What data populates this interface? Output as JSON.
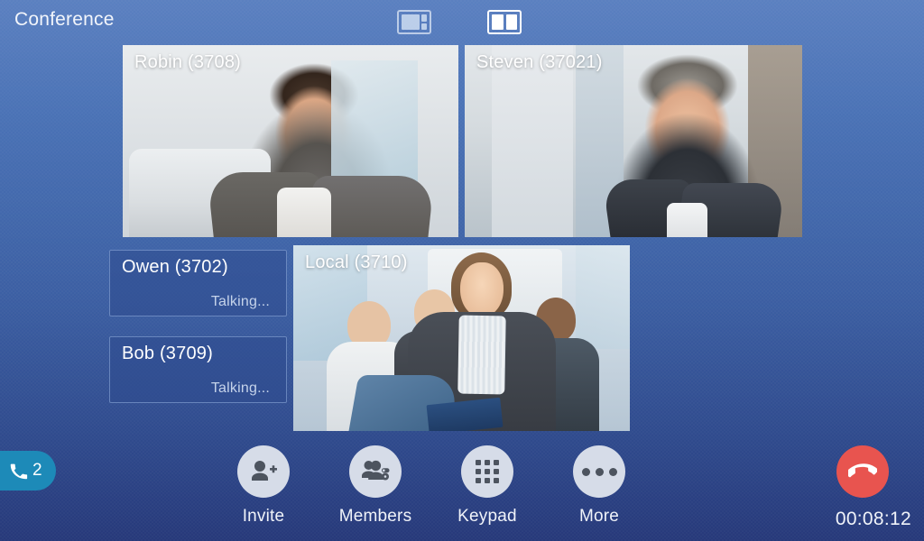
{
  "header": {
    "title": "Conference",
    "layout_buttons": [
      {
        "name": "layout-one-plus-two",
        "active": false
      },
      {
        "name": "layout-two-equal",
        "active": true
      }
    ]
  },
  "video_tiles": [
    {
      "id": "robin",
      "label": "Robin (3708)",
      "type": "video"
    },
    {
      "id": "steven",
      "label": "Steven (37021)",
      "type": "video"
    },
    {
      "id": "local",
      "label": "Local (3710)",
      "type": "video"
    }
  ],
  "audio_tiles": [
    {
      "id": "owen",
      "name": "Owen (3702)",
      "status": "Talking..."
    },
    {
      "id": "bob",
      "name": "Bob (3709)",
      "status": "Talking..."
    }
  ],
  "call_badge": {
    "icon": "phone-handset-icon",
    "count": "2",
    "color": "#1d8ab8"
  },
  "toolbar": {
    "actions": [
      {
        "id": "invite",
        "label": "Invite",
        "icon": "person-add-icon"
      },
      {
        "id": "members",
        "label": "Members",
        "icon": "people-settings-icon"
      },
      {
        "id": "keypad",
        "label": "Keypad",
        "icon": "dialpad-grid-icon"
      },
      {
        "id": "more",
        "label": "More",
        "icon": "ellipsis-icon"
      }
    ],
    "hangup": {
      "icon": "hangup-handset-icon",
      "color": "#e8544f"
    },
    "timer": "00:08:12"
  },
  "colors": {
    "background_top": "#5b80c0",
    "background_bottom": "#27397a",
    "accent_cyan": "#1d8ab8",
    "hangup_red": "#e8544f",
    "button_face": "#d6dce8",
    "text_primary": "#ffffff",
    "text_secondary": "#c5d3ea"
  }
}
